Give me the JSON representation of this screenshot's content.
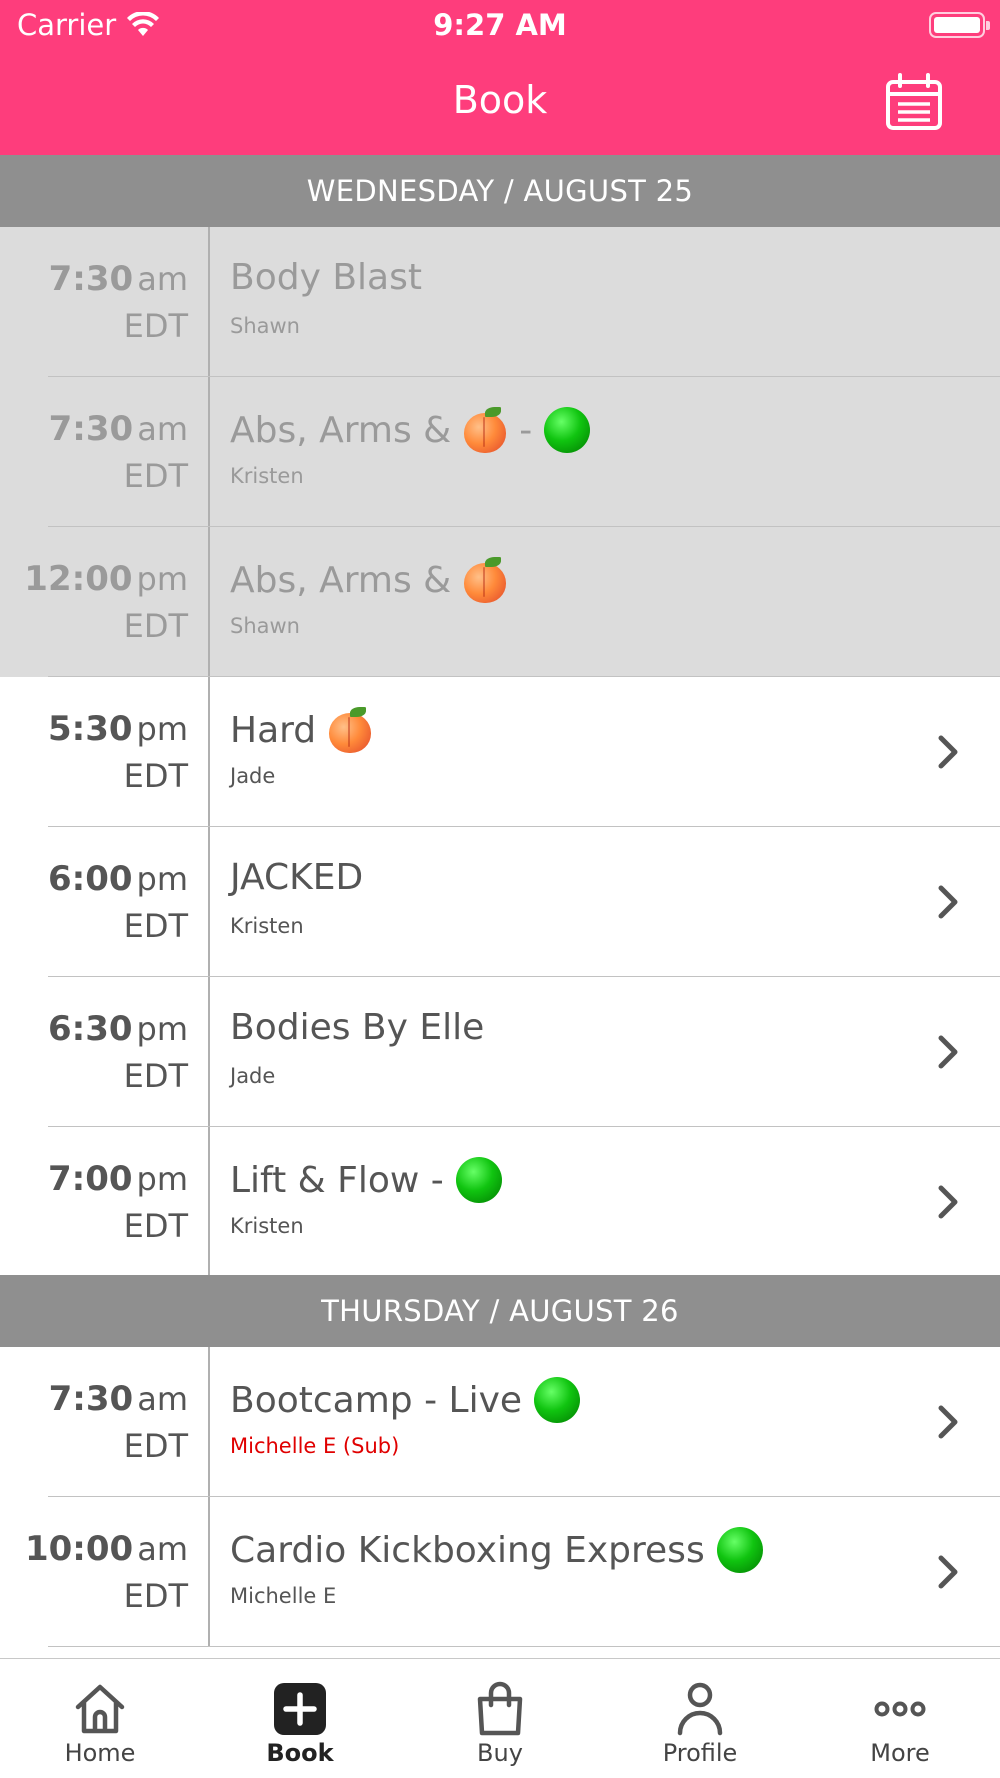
{
  "status_bar": {
    "carrier": "Carrier",
    "time": "9:27 AM"
  },
  "nav": {
    "title": "Book",
    "calendar_icon": "calendar-icon"
  },
  "days": [
    {
      "header": "WEDNESDAY / AUGUST 25",
      "classes": [
        {
          "time": "7:30",
          "ampm": "am",
          "tz": "EDT",
          "name": "Body Blast",
          "instructor": "Shawn",
          "past": true
        },
        {
          "time": "7:30",
          "ampm": "am",
          "tz": "EDT",
          "name": "Abs, Arms &",
          "after_emoji": "-",
          "instructor": "Kristen",
          "past": true
        },
        {
          "time": "12:00",
          "ampm": "pm",
          "tz": "EDT",
          "name": "Abs, Arms &",
          "instructor": "Shawn",
          "past": true
        },
        {
          "time": "5:30",
          "ampm": "pm",
          "tz": "EDT",
          "name": "Hard",
          "instructor": "Jade",
          "past": false
        },
        {
          "time": "6:00",
          "ampm": "pm",
          "tz": "EDT",
          "name": "JACKED",
          "instructor": "Kristen",
          "past": false
        },
        {
          "time": "6:30",
          "ampm": "pm",
          "tz": "EDT",
          "name": "Bodies By Elle",
          "instructor": "Jade",
          "past": false
        },
        {
          "time": "7:00",
          "ampm": "pm",
          "tz": "EDT",
          "name": "Lift & Flow -",
          "instructor": "Kristen",
          "past": false
        }
      ]
    },
    {
      "header": "THURSDAY / AUGUST 26",
      "classes": [
        {
          "time": "7:30",
          "ampm": "am",
          "tz": "EDT",
          "name": "Bootcamp - Live",
          "instructor": "Michelle E (Sub)",
          "past": false
        },
        {
          "time": "10:00",
          "ampm": "am",
          "tz": "EDT",
          "name": "Cardio Kickboxing Express",
          "instructor": "Michelle E",
          "past": false
        }
      ]
    }
  ],
  "tabs": [
    {
      "label": "Home",
      "icon": "home-icon"
    },
    {
      "label": "Book",
      "icon": "plus-icon",
      "active": true
    },
    {
      "label": "Buy",
      "icon": "shopping-bag-icon"
    },
    {
      "label": "Profile",
      "icon": "person-icon"
    },
    {
      "label": "More",
      "icon": "more-dots-icon"
    }
  ],
  "colors": {
    "brand": "#fe3d7c",
    "day_header": "#8f8f8f",
    "past_row": "#dcdcdc",
    "sub_instructor": "#e00000",
    "live_dot": "#10c410"
  }
}
